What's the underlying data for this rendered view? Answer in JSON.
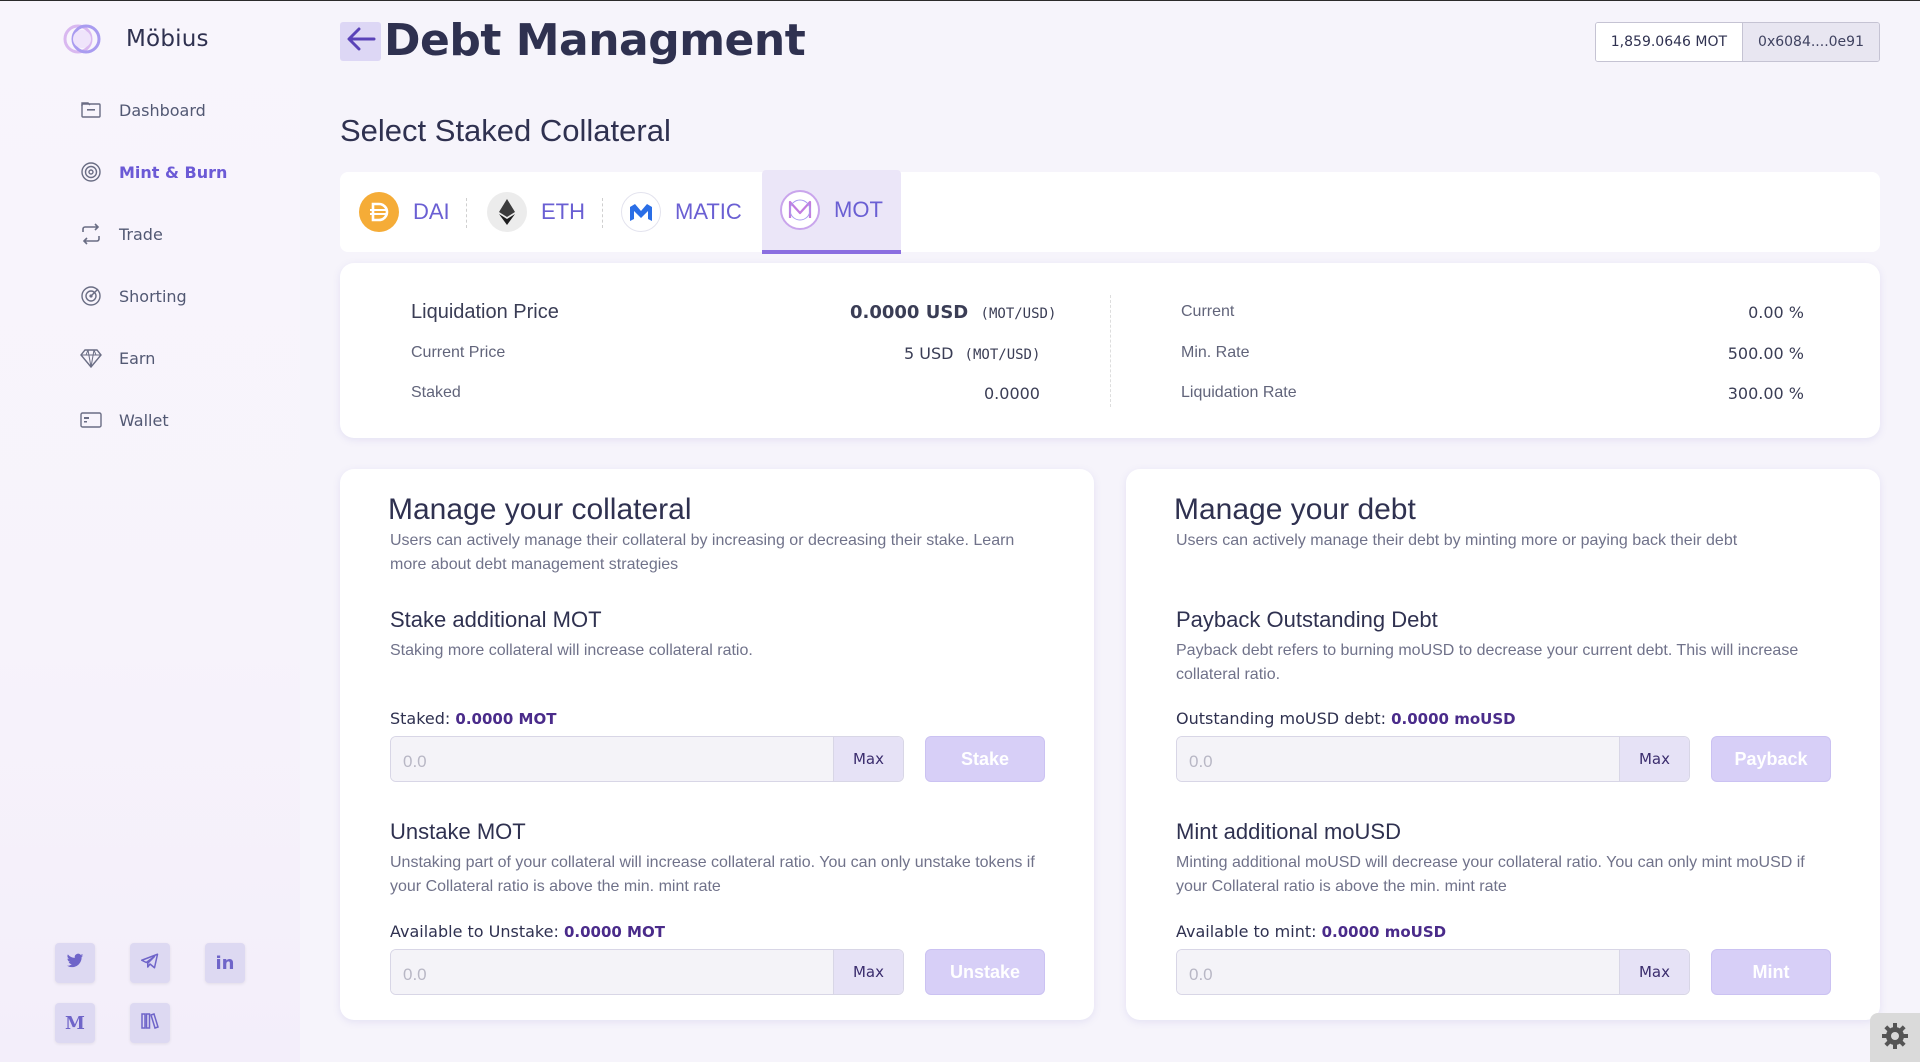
{
  "app": {
    "name": "Möbius"
  },
  "sidebar": {
    "items": [
      {
        "label": "Dashboard",
        "icon": "folder-icon"
      },
      {
        "label": "Mint & Burn",
        "icon": "spiral-icon",
        "active": true
      },
      {
        "label": "Trade",
        "icon": "swap-icon"
      },
      {
        "label": "Shorting",
        "icon": "target-icon"
      },
      {
        "label": "Earn",
        "icon": "diamond-icon"
      },
      {
        "label": "Wallet",
        "icon": "wallet-icon"
      }
    ],
    "socials": [
      "twitter-icon",
      "telegram-icon",
      "linkedin-icon",
      "medium-icon",
      "docs-icon"
    ],
    "social_text": {
      "linkedin": "in",
      "medium": "M"
    }
  },
  "header": {
    "title": "Debt Managment",
    "balance": "1,859.0646 MOT",
    "address": "0x6084....0e91"
  },
  "collateral_select": {
    "title": "Select Staked Collateral",
    "tabs": [
      {
        "label": "DAI",
        "icon": "dai-icon",
        "color": "#f5ac37"
      },
      {
        "label": "ETH",
        "icon": "eth-icon",
        "color": "#3c3c3d"
      },
      {
        "label": "MATIC",
        "icon": "matic-icon",
        "color": "#2a6ee6"
      },
      {
        "label": "MOT",
        "icon": "mot-icon",
        "active": true,
        "color": "#b07de0"
      }
    ]
  },
  "stats": {
    "liquidation_price_label": "Liquidation Price",
    "liquidation_price_value": "0.0000 USD",
    "liquidation_price_unit": "(MOT/USD)",
    "current_price_label": "Current Price",
    "current_price_value": "5 USD",
    "current_price_unit": "(MOT/USD)",
    "staked_label": "Staked",
    "staked_value": "0.0000",
    "current_label": "Current",
    "current_value": "0.00 %",
    "min_rate_label": "Min. Rate",
    "min_rate_value": "500.00 %",
    "liquidation_rate_label": "Liquidation Rate",
    "liquidation_rate_value": "300.00 %"
  },
  "collateral_card": {
    "title": "Manage your collateral",
    "description": "Users can actively manage their collateral by increasing or decreasing their stake. Learn more about debt management strategies",
    "stake": {
      "title": "Stake additional  MOT",
      "description": "Staking more collateral will increase collateral ratio.",
      "meta_label": "Staked:",
      "meta_value": "0.0000 MOT",
      "placeholder": "0.0",
      "max_label": "Max",
      "button_label": "Stake"
    },
    "unstake": {
      "title": "Unstake  MOT",
      "description": "Unstaking part of your collateral will increase collateral ratio. You can only unstake tokens if your Collateral ratio is above the min. mint rate",
      "meta_label": "Available to Unstake:",
      "meta_value": "0.0000 MOT",
      "placeholder": "0.0",
      "max_label": "Max",
      "button_label": "Unstake"
    }
  },
  "debt_card": {
    "title": "Manage your debt",
    "description": "Users can actively manage their debt by minting more or paying back their debt",
    "payback": {
      "title": "Payback Outstanding Debt",
      "description": "Payback debt refers to burning moUSD to decrease your current debt. This will increase collateral ratio.",
      "meta_label": "Outstanding moUSD debt:",
      "meta_value": "0.0000 moUSD",
      "placeholder": "0.0",
      "max_label": "Max",
      "button_label": "Payback"
    },
    "mint": {
      "title": "Mint additional moUSD",
      "description": "Minting additional moUSD will decrease your collateral ratio. You can only mint moUSD if your Collateral ratio is above the min. mint rate",
      "meta_label": "Available to mint:",
      "meta_value": "0.0000 moUSD",
      "placeholder": "0.0",
      "max_label": "Max",
      "button_label": "Mint"
    }
  },
  "colors": {
    "accent": "#6c5ad6",
    "button_disabled": "#d7cff7",
    "highlight_value": "#4a2b8a"
  }
}
